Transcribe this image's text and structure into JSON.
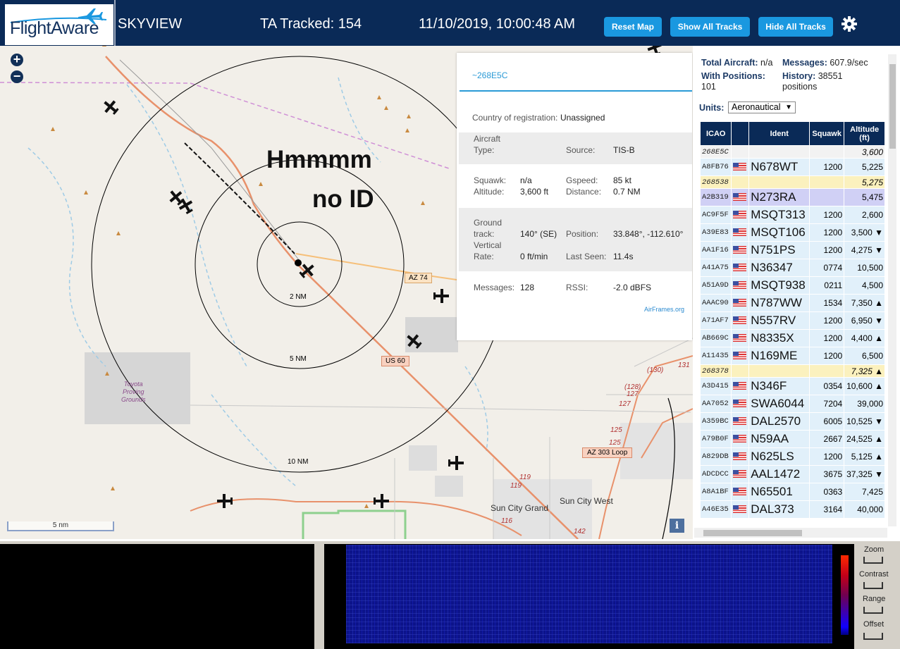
{
  "header": {
    "logo_text": "FlightAware",
    "app_name": "SKYVIEW",
    "tracked": "TA Tracked: 154",
    "datetime": "11/10/2019, 10:00:48 AM",
    "reset_map": "Reset Map",
    "show_all": "Show All Tracks",
    "hide_all": "Hide All Tracks",
    "settings_icon": "gear-icon"
  },
  "map": {
    "zoom_in": "+",
    "zoom_out": "−",
    "annotation_line1": "Hmmmm",
    "annotation_line2": "no ID",
    "range_rings": [
      "2 NM",
      "5 NM",
      "10 NM"
    ],
    "road_labels": [
      "AZ 74",
      "US 60",
      "AZ 303 Loop"
    ],
    "route_numbers": [
      "(130)",
      "131",
      "(128)",
      "127",
      "127",
      "125",
      "125",
      "119",
      "119",
      "116",
      "142"
    ],
    "places": [
      "Sun City Grand",
      "Sun City West"
    ],
    "proving_grounds": "Toyota\nProving\nGrounds",
    "scale": "5 nm",
    "info_button": "i"
  },
  "popup": {
    "hex": "~268E5C",
    "country_label": "Country of registration:",
    "country_value": "Unassigned",
    "aircraft_type_label": "Aircraft",
    "aircraft_type_label2": "Type:",
    "source_label": "Source:",
    "source_value": "TIS-B",
    "squawk_label": "Squawk:",
    "squawk_value": "n/a",
    "altitude_label": "Altitude:",
    "altitude_value": "3,600 ft",
    "gspeed_label": "Gspeed:",
    "gspeed_value": "85 kt",
    "distance_label": "Distance:",
    "distance_value": "0.7 NM",
    "ground_label1": "Ground",
    "ground_label2": "track:",
    "ground_value": "140° (SE)",
    "position_label": "Position:",
    "position_value": "33.848°, -112.610°",
    "vrate_label1": "Vertical",
    "vrate_label2": "Rate:",
    "vrate_value": "0 ft/min",
    "lastseen_label": "Last Seen:",
    "lastseen_value": "11.4s",
    "messages_label": "Messages:",
    "messages_value": "128",
    "rssi_label": "RSSI:",
    "rssi_value": "-2.0 dBFS",
    "airframes_link": "AirFrames.org"
  },
  "panel": {
    "total_label": "Total Aircraft:",
    "total_value": "n/a",
    "messages_label": "Messages:",
    "messages_value": "607.9/sec",
    "withpos_label": "With Positions:",
    "withpos_value": "101",
    "history_label": "History:",
    "history_value": "38551",
    "history_unit": "positions",
    "units_label": "Units:",
    "units_value": "Aeronautical",
    "columns": [
      "ICAO",
      "",
      "Ident",
      "Squawk",
      "Altitude (ft)"
    ],
    "rows": [
      {
        "icao": "268E5C",
        "ident": "",
        "squawk": "",
        "alt": "3,600",
        "kind": "nopos",
        "flag": false
      },
      {
        "icao": "A8FB76",
        "ident": "N678WT",
        "squawk": "1200",
        "alt": "5,225",
        "kind": "",
        "flag": true
      },
      {
        "icao": "268538",
        "ident": "",
        "squawk": "",
        "alt": "5,275",
        "kind": "tisb",
        "flag": false
      },
      {
        "icao": "A2B319",
        "ident": "N273RA",
        "squawk": "",
        "alt": "5,475",
        "kind": "sel",
        "flag": true
      },
      {
        "icao": "AC9F5F",
        "ident": "MSQT313",
        "squawk": "1200",
        "alt": "2,600",
        "kind": "",
        "flag": true
      },
      {
        "icao": "A39E83",
        "ident": "MSQT106",
        "squawk": "1200",
        "alt": "3,500 ▼",
        "kind": "",
        "flag": true
      },
      {
        "icao": "AA1F16",
        "ident": "N751PS",
        "squawk": "1200",
        "alt": "4,275 ▼",
        "kind": "",
        "flag": true
      },
      {
        "icao": "A41A75",
        "ident": "N36347",
        "squawk": "0774",
        "alt": "10,500",
        "kind": "",
        "flag": true
      },
      {
        "icao": "A51A9D",
        "ident": "MSQT938",
        "squawk": "0211",
        "alt": "4,500",
        "kind": "",
        "flag": true
      },
      {
        "icao": "AAAC90",
        "ident": "N787WW",
        "squawk": "1534",
        "alt": "7,350 ▲",
        "kind": "",
        "flag": true
      },
      {
        "icao": "A71AF7",
        "ident": "N557RV",
        "squawk": "1200",
        "alt": "6,950 ▼",
        "kind": "",
        "flag": true
      },
      {
        "icao": "AB669C",
        "ident": "N8335X",
        "squawk": "1200",
        "alt": "4,400 ▲",
        "kind": "",
        "flag": true
      },
      {
        "icao": "A11435",
        "ident": "N169ME",
        "squawk": "1200",
        "alt": "6,500",
        "kind": "",
        "flag": true
      },
      {
        "icao": "268378",
        "ident": "",
        "squawk": "",
        "alt": "7,325 ▲",
        "kind": "tisb",
        "flag": false
      },
      {
        "icao": "A3D415",
        "ident": "N346F",
        "squawk": "0354",
        "alt": "10,600 ▲",
        "kind": "",
        "flag": true
      },
      {
        "icao": "AA7052",
        "ident": "SWA6044",
        "squawk": "7204",
        "alt": "39,000",
        "kind": "",
        "flag": true
      },
      {
        "icao": "A359BC",
        "ident": "DAL2570",
        "squawk": "6005",
        "alt": "10,525 ▼",
        "kind": "",
        "flag": true
      },
      {
        "icao": "A79B0F",
        "ident": "N59AA",
        "squawk": "2667",
        "alt": "24,525 ▲",
        "kind": "",
        "flag": true
      },
      {
        "icao": "A829DB",
        "ident": "N625LS",
        "squawk": "1200",
        "alt": "5,125 ▲",
        "kind": "",
        "flag": true
      },
      {
        "icao": "ADCDCC",
        "ident": "AAL1472",
        "squawk": "3675",
        "alt": "37,325 ▼",
        "kind": "",
        "flag": true
      },
      {
        "icao": "A8A1BF",
        "ident": "N65501",
        "squawk": "0363",
        "alt": "7,425",
        "kind": "",
        "flag": true
      },
      {
        "icao": "A46E35",
        "ident": "DAL373",
        "squawk": "3164",
        "alt": "40,000",
        "kind": "",
        "flag": true
      }
    ]
  },
  "waterfall": {
    "zoom": "Zoom",
    "contrast": "Contrast",
    "range": "Range",
    "offset": "Offset"
  }
}
